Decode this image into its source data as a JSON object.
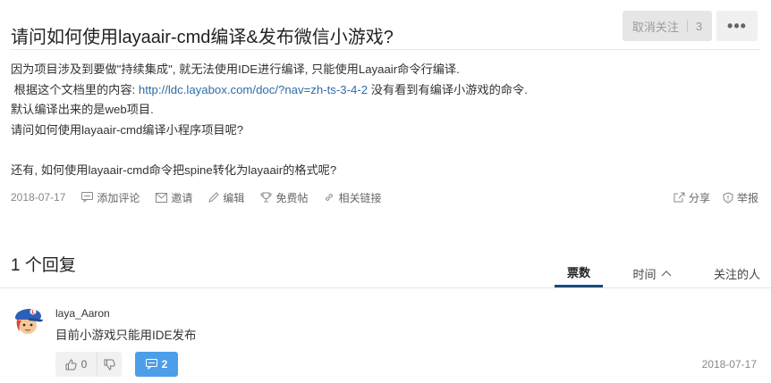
{
  "question": {
    "title": "请问如何使用layaair-cmd编译&发布微信小游戏?",
    "unfollow_label": "取消关注",
    "follow_count": "3",
    "more_label": "•••",
    "body_lines": [
      "因为项目涉及到要做\"持续集成\", 就无法使用IDE进行编译, 只能使用Layaair命令行编译.",
      "",
      "默认编译出来的是web项目.",
      "请问如何使用layaair-cmd编译小程序项目呢?",
      "",
      "还有, 如何使用layaair-cmd命令把spine转化为layaair的格式呢?"
    ],
    "doc_line_prefix": " 根据这个文档里的内容: ",
    "doc_link": "http://ldc.layabox.com/doc/?nav=zh-ts-3-4-2",
    "doc_line_suffix": " 没有看到有编译小游戏的命令.",
    "date": "2018-07-17",
    "actions": {
      "add_comment": "添加评论",
      "invite": "邀请",
      "edit": "编辑",
      "free_post": "免费帖",
      "related_links": "相关链接",
      "share": "分享",
      "report": "举报"
    }
  },
  "answers_header": {
    "count_label": "1 个回复",
    "sort_tabs": [
      "票数",
      "时间",
      "关注的人"
    ],
    "active_tab": "票数"
  },
  "answer": {
    "username": "laya_Aaron",
    "text": "目前小游戏只能用IDE发布",
    "upvotes": "0",
    "comments": "2",
    "date": "2018-07-17"
  },
  "colors": {
    "link": "#2d6ca8",
    "comment_button": "#4d9ee8",
    "active_tab_underline": "#1a4b7e"
  }
}
